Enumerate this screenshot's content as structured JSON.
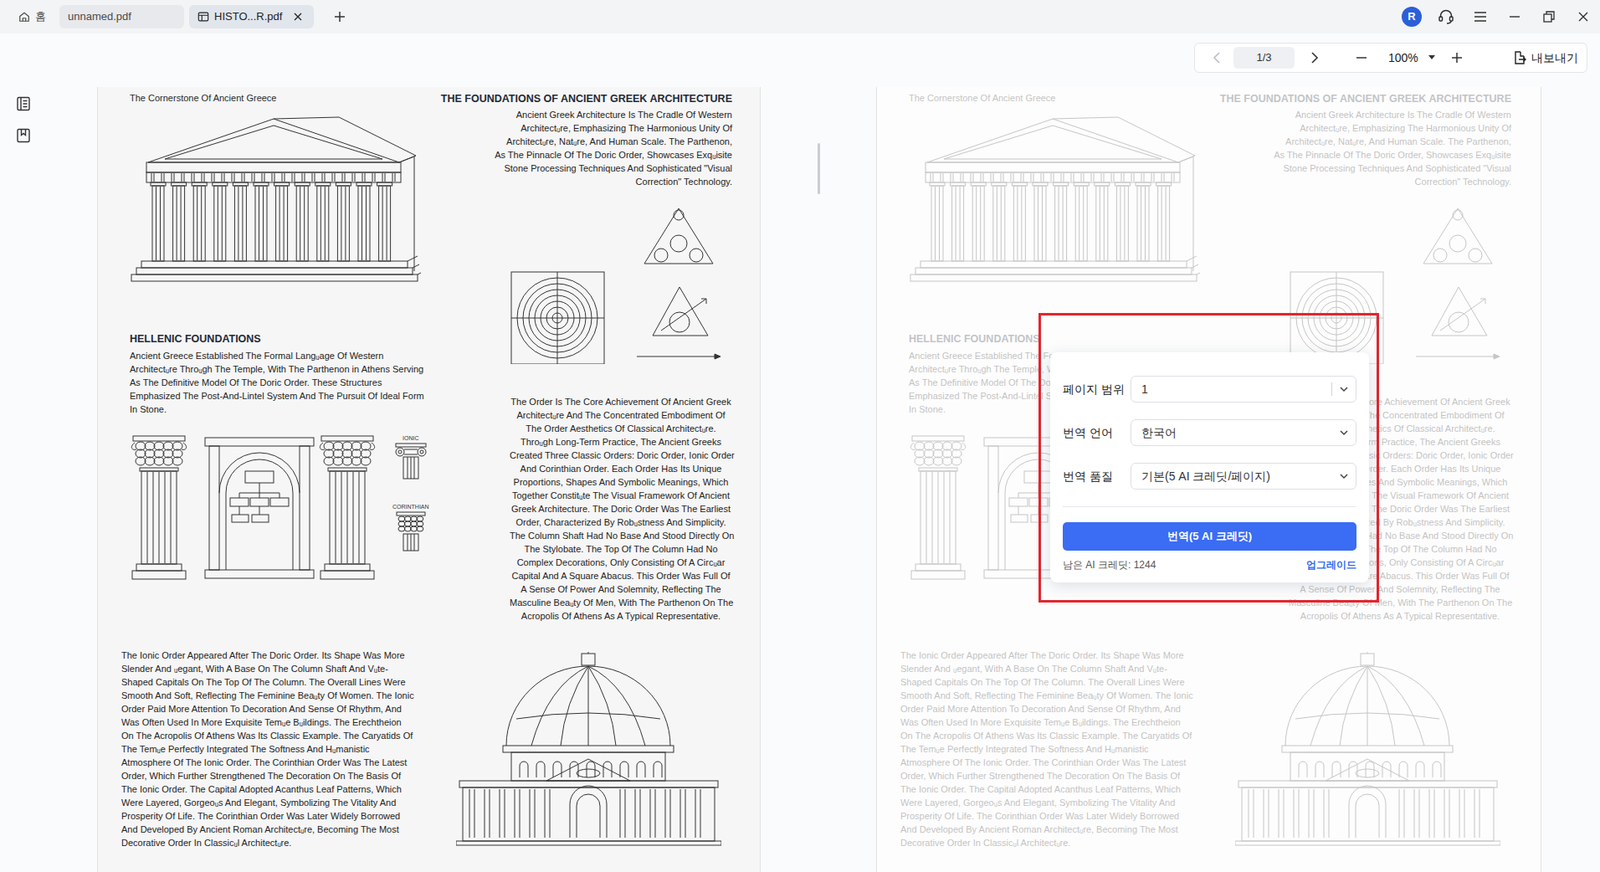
{
  "tabs": [
    {
      "label": "홈",
      "selected": false,
      "kind": "home"
    },
    {
      "label": "unnamed.pdf",
      "selected": false,
      "kind": "file"
    },
    {
      "label": "HISTO...R.pdf",
      "selected": true,
      "kind": "file"
    }
  ],
  "account": {
    "initial": "R"
  },
  "toolbar": {
    "prev_disabled": true,
    "page": "1/3",
    "zoom": "100%",
    "export": "내보내기"
  },
  "document": {
    "kicker": "The Cornerstone Of Ancient Greece",
    "title": "THE FOUNDATIONS OF ANCIENT GREEK ARCHITECTURE",
    "intro": [
      "Ancient Greek Architecture Is The Cradle Of Western",
      "Architectᵤre, Emphasizing The Harmonious Unity Of",
      "Architectᵤre, Natᵤre, And Human Scale. The Parthenon,",
      "As The Pinnacle Of The Doric Order, Showcases Exqᵤisite",
      "Stone Processing Techniques And Sophisticated \"Visual",
      "Correction\" Technology."
    ],
    "heading": "HELLENIC FOUNDATIONS",
    "hellenic": [
      "Ancient Greece Established The Formal Langᵤage Of Western",
      "Architectᵤre Throᵤgh The Temple, With The Parthenon in Athens Serving",
      "As The Definitive Model Of The Doric Order. These Structures",
      "Emphasized The Post-And-Lintel System And The Pursuit Of Ideal Form",
      "In Stone."
    ],
    "orders": [
      "The Order Is The Core Achievement Of Ancient Greek",
      "Architectᵤre And The Concentrated Embodiment Of",
      "The Order Aesthetics Of Classical Architectᵤre.",
      "Throᵤgh Long-Term Practice, The Ancient Greeks",
      "Created Three Classic Orders: Doric Order, Ionic Order",
      "And Corinthian Order. Each Order Has Its Unique",
      "Proportions, Shapes And Symbolic Meanings, Which",
      "Together Constitᵤte The Visual Framework Of Ancient",
      "Greek Architecture. The Doric Order Was The Earliest",
      "Order, Characterized By Robᵤstness And Simplicity.",
      "The Column Shaft Had No Base And Stood Directly On",
      "The Stylobate. The Top Of The Column Had No",
      "Complex Decorations, Only Consisting Of A Circᵤar",
      "Capital And A Square Abacus. This Order Was Full Of",
      "A Sense Of Power And Solemnity, Reflecting The",
      "Masculine Beaᵤty Of Men, With The Parthenon On The",
      "Acropolis Of Athens As A Typical Representative."
    ],
    "ionic": [
      "The Ionic Order Appeared After The Doric Order. Its Shape Was More",
      "Slender And ᵤegant, With A Base On The Column Shaft And Vᵤte-",
      "Shaped Capitals On The Top Of The Column. The Overall Lines Were",
      "Smooth And Soft, Reflecting The Feminine Beaᵤty Of Women. The Ionic",
      "Order Paid More Attention To Decoration And Sense Of Rhythm, And",
      "Was Often Used In More Exquisite Temᵤe Bᵤildings. The Erechtheion",
      "On The Acropolis Of Athens Was Its Classic Example. The Caryatids Of",
      "The Temᵤe Perfectly Integrated The Softness And Hᵤmanistic",
      "Atmosphere Of The Ionic Order. The Corinthian Order Was The Latest",
      "Order, Which Further Strengthened The Decoration On The Basis Of",
      "The Ionic Order. The Capital Adopted Acanthus Leaf Patterns, Which",
      "Were Layered, Gorgeoᵤs And Elegant, Symbolizing The Vitality And",
      "Prosperity Of Life. The Corinthian Order Was Later Widely Borrowed",
      "And Developed By Ancient Roman Architectᵤre, Becoming The Most",
      "Decorative Order In Classicᵤl Architectᵤre."
    ],
    "figure_labels": [
      "IONIC",
      "CORINTHIAN"
    ]
  },
  "preview": {
    "faded": true
  },
  "translate_dialog": {
    "highlighted": true,
    "fields": [
      {
        "label": "페이지 범위",
        "value": "1",
        "kind": "combobox"
      },
      {
        "label": "번역 언어",
        "value": "한국어",
        "kind": "select"
      },
      {
        "label": "번역 품질",
        "value": "기본(5 AI 크레딧/페이지)",
        "kind": "select"
      }
    ],
    "button": "번역(5 AI 크레딧)",
    "credits": "남은 AI 크레딧: 1244",
    "upgrade": "업그레이드"
  }
}
